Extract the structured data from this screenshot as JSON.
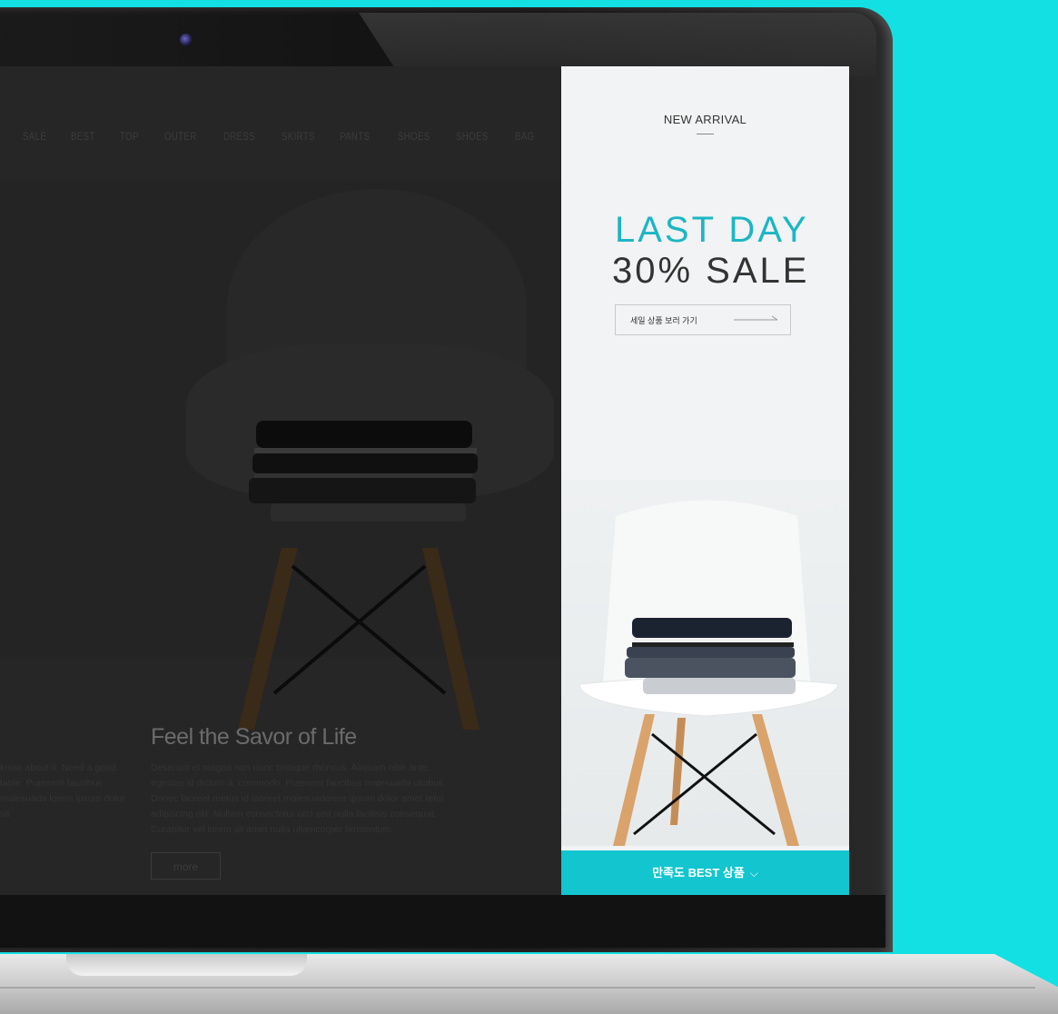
{
  "nav": {
    "items": [
      "SALE",
      "BEST",
      "TOP",
      "OUTER",
      "DRESS",
      "SKIRTS",
      "PANTS",
      "SHOES",
      "SHOES",
      "BAG"
    ]
  },
  "site": {
    "feel_title": "Feel the Savor of Life",
    "feel_body": "Deserunt et magna non nunc tristique rhoncus. Aliquam nibh ante, egestas id dictum a, commodo. Praesent faucibus malesuada ulcibus. Donec laoreet metus id laoreet malesuadarenr ipsum dolor amet tetur adipiscing elit. Nullam consectetur orci sed nulla facilisis consequat. Curabitur vel lorem sit amet nulla ullamcorper fermentum.",
    "left_body": "know about it. Need a good table. Praesent faucibus malesuada lorem ipsum dolor sit",
    "more_label": "more"
  },
  "panel": {
    "new_arrival": "NEW ARRIVAL",
    "last_day": "LAST DAY",
    "sale": "30% SALE",
    "sale_button_label": "세일 상품 보러 가기",
    "best_label": "만족도 BEST 상품",
    "chevron": "⌵"
  },
  "colors": {
    "background": "#13e0e3",
    "accent": "#1cb6c4",
    "best_bar": "#12c5cf"
  }
}
